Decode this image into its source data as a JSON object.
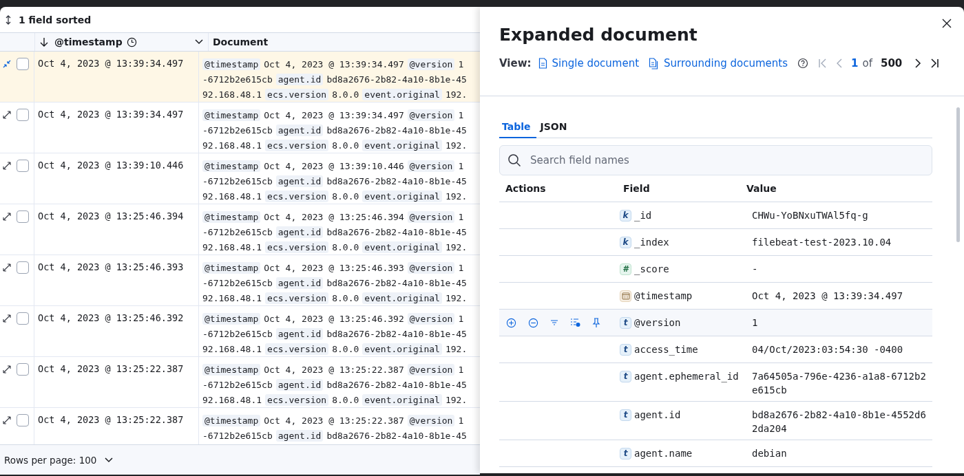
{
  "toolbar": {
    "sort_label": "1 field sorted"
  },
  "grid": {
    "columns": [
      {
        "label": "@timestamp",
        "kind": "time"
      },
      {
        "label": "Document",
        "kind": "document"
      }
    ],
    "rows": [
      {
        "expanded": true,
        "checked": false,
        "timestamp": "Oct 4, 2023 @ 13:39:34.497",
        "document": [
          [
            {
              "kind": "key",
              "text": "@timestamp"
            },
            {
              "kind": "value",
              "text": "Oct 4, 2023 @ 13:39:34.497"
            },
            {
              "kind": "key",
              "text": "@version"
            },
            {
              "kind": "value",
              "text": "1"
            }
          ],
          [
            {
              "kind": "value",
              "text": "-6712b2e615cb"
            },
            {
              "kind": "key",
              "text": "agent.id"
            },
            {
              "kind": "value",
              "text": "bd8a2676-2b82-4a10-8b1e-45"
            }
          ],
          [
            {
              "kind": "value",
              "text": "92.168.48.1"
            },
            {
              "kind": "key",
              "text": "ecs.version"
            },
            {
              "kind": "value",
              "text": "8.0.0"
            },
            {
              "kind": "key",
              "text": "event.original"
            },
            {
              "kind": "value",
              "text": "192."
            }
          ]
        ]
      },
      {
        "expanded": false,
        "checked": false,
        "timestamp": "Oct 4, 2023 @ 13:39:34.497",
        "document": [
          [
            {
              "kind": "key",
              "text": "@timestamp"
            },
            {
              "kind": "value",
              "text": "Oct 4, 2023 @ 13:39:34.497"
            },
            {
              "kind": "key",
              "text": "@version"
            },
            {
              "kind": "value",
              "text": "1"
            }
          ],
          [
            {
              "kind": "value",
              "text": "-6712b2e615cb"
            },
            {
              "kind": "key",
              "text": "agent.id"
            },
            {
              "kind": "value",
              "text": "bd8a2676-2b82-4a10-8b1e-45"
            }
          ],
          [
            {
              "kind": "value",
              "text": "92.168.48.1"
            },
            {
              "kind": "key",
              "text": "ecs.version"
            },
            {
              "kind": "value",
              "text": "8.0.0"
            },
            {
              "kind": "key",
              "text": "event.original"
            },
            {
              "kind": "value",
              "text": "192."
            }
          ]
        ]
      },
      {
        "expanded": false,
        "checked": false,
        "timestamp": "Oct 4, 2023 @ 13:39:10.446",
        "document": [
          [
            {
              "kind": "key",
              "text": "@timestamp"
            },
            {
              "kind": "value",
              "text": "Oct 4, 2023 @ 13:39:10.446"
            },
            {
              "kind": "key",
              "text": "@version"
            },
            {
              "kind": "value",
              "text": "1"
            }
          ],
          [
            {
              "kind": "value",
              "text": "-6712b2e615cb"
            },
            {
              "kind": "key",
              "text": "agent.id"
            },
            {
              "kind": "value",
              "text": "bd8a2676-2b82-4a10-8b1e-45"
            }
          ],
          [
            {
              "kind": "value",
              "text": "92.168.48.1"
            },
            {
              "kind": "key",
              "text": "ecs.version"
            },
            {
              "kind": "value",
              "text": "8.0.0"
            },
            {
              "kind": "key",
              "text": "event.original"
            },
            {
              "kind": "value",
              "text": "192."
            }
          ]
        ]
      },
      {
        "expanded": false,
        "checked": false,
        "timestamp": "Oct 4, 2023 @ 13:25:46.394",
        "document": [
          [
            {
              "kind": "key",
              "text": "@timestamp"
            },
            {
              "kind": "value",
              "text": "Oct 4, 2023 @ 13:25:46.394"
            },
            {
              "kind": "key",
              "text": "@version"
            },
            {
              "kind": "value",
              "text": "1"
            }
          ],
          [
            {
              "kind": "value",
              "text": "-6712b2e615cb"
            },
            {
              "kind": "key",
              "text": "agent.id"
            },
            {
              "kind": "value",
              "text": "bd8a2676-2b82-4a10-8b1e-45"
            }
          ],
          [
            {
              "kind": "value",
              "text": "92.168.48.1"
            },
            {
              "kind": "key",
              "text": "ecs.version"
            },
            {
              "kind": "value",
              "text": "8.0.0"
            },
            {
              "kind": "key",
              "text": "event.original"
            },
            {
              "kind": "value",
              "text": "192."
            }
          ]
        ]
      },
      {
        "expanded": false,
        "checked": false,
        "timestamp": "Oct 4, 2023 @ 13:25:46.393",
        "document": [
          [
            {
              "kind": "key",
              "text": "@timestamp"
            },
            {
              "kind": "value",
              "text": "Oct 4, 2023 @ 13:25:46.393"
            },
            {
              "kind": "key",
              "text": "@version"
            },
            {
              "kind": "value",
              "text": "1"
            }
          ],
          [
            {
              "kind": "value",
              "text": "-6712b2e615cb"
            },
            {
              "kind": "key",
              "text": "agent.id"
            },
            {
              "kind": "value",
              "text": "bd8a2676-2b82-4a10-8b1e-45"
            }
          ],
          [
            {
              "kind": "value",
              "text": "92.168.48.1"
            },
            {
              "kind": "key",
              "text": "ecs.version"
            },
            {
              "kind": "value",
              "text": "8.0.0"
            },
            {
              "kind": "key",
              "text": "event.original"
            },
            {
              "kind": "value",
              "text": "192."
            }
          ]
        ]
      },
      {
        "expanded": false,
        "checked": false,
        "timestamp": "Oct 4, 2023 @ 13:25:46.392",
        "document": [
          [
            {
              "kind": "key",
              "text": "@timestamp"
            },
            {
              "kind": "value",
              "text": "Oct 4, 2023 @ 13:25:46.392"
            },
            {
              "kind": "key",
              "text": "@version"
            },
            {
              "kind": "value",
              "text": "1"
            }
          ],
          [
            {
              "kind": "value",
              "text": "-6712b2e615cb"
            },
            {
              "kind": "key",
              "text": "agent.id"
            },
            {
              "kind": "value",
              "text": "bd8a2676-2b82-4a10-8b1e-45"
            }
          ],
          [
            {
              "kind": "value",
              "text": "92.168.48.1"
            },
            {
              "kind": "key",
              "text": "ecs.version"
            },
            {
              "kind": "value",
              "text": "8.0.0"
            },
            {
              "kind": "key",
              "text": "event.original"
            },
            {
              "kind": "value",
              "text": "192."
            }
          ]
        ]
      },
      {
        "expanded": false,
        "checked": false,
        "timestamp": "Oct 4, 2023 @ 13:25:22.387",
        "document": [
          [
            {
              "kind": "key",
              "text": "@timestamp"
            },
            {
              "kind": "value",
              "text": "Oct 4, 2023 @ 13:25:22.387"
            },
            {
              "kind": "key",
              "text": "@version"
            },
            {
              "kind": "value",
              "text": "1"
            }
          ],
          [
            {
              "kind": "value",
              "text": "-6712b2e615cb"
            },
            {
              "kind": "key",
              "text": "agent.id"
            },
            {
              "kind": "value",
              "text": "bd8a2676-2b82-4a10-8b1e-45"
            }
          ],
          [
            {
              "kind": "value",
              "text": "92.168.48.1"
            },
            {
              "kind": "key",
              "text": "ecs.version"
            },
            {
              "kind": "value",
              "text": "8.0.0"
            },
            {
              "kind": "key",
              "text": "event.original"
            },
            {
              "kind": "value",
              "text": "192."
            }
          ]
        ]
      },
      {
        "expanded": false,
        "checked": false,
        "timestamp": "Oct 4, 2023 @ 13:25:22.387",
        "document": [
          [
            {
              "kind": "key",
              "text": "@timestamp"
            },
            {
              "kind": "value",
              "text": "Oct 4, 2023 @ 13:25:22.387"
            },
            {
              "kind": "key",
              "text": "@version"
            },
            {
              "kind": "value",
              "text": "1"
            }
          ],
          [
            {
              "kind": "value",
              "text": "-6712b2e615cb"
            },
            {
              "kind": "key",
              "text": "agent.id"
            },
            {
              "kind": "value",
              "text": "bd8a2676-2b82-4a10-8b1e-45"
            }
          ]
        ]
      }
    ]
  },
  "pagination": {
    "rows_per_page": "Rows per page: 100"
  },
  "flyout": {
    "title": "Expanded document",
    "view_label": "View:",
    "views": [
      {
        "kind": "single",
        "label": "Single document"
      },
      {
        "kind": "surrounding",
        "label": "Surrounding documents"
      }
    ],
    "pager": {
      "current": "1",
      "of": "of",
      "total": "500"
    },
    "tabs": [
      {
        "label": "Table",
        "selected": true
      },
      {
        "label": "JSON",
        "selected": false
      }
    ],
    "search": {
      "placeholder": "Search field names"
    },
    "columns": [
      "Actions",
      "Field",
      "Value"
    ],
    "fields": [
      {
        "kind": "keyword",
        "badge": "k",
        "name": "_id",
        "value": "CHWu-YoBNxuTWAl5fq-g",
        "highlighted": false
      },
      {
        "kind": "keyword",
        "badge": "k",
        "name": "_index",
        "value": "filebeat-test-2023.10.04",
        "highlighted": false
      },
      {
        "kind": "number",
        "badge": "#",
        "name": "_score",
        "value": "-",
        "highlighted": false
      },
      {
        "kind": "date",
        "name": "@timestamp",
        "value": "Oct 4, 2023 @ 13:39:34.497",
        "highlighted": false
      },
      {
        "kind": "text",
        "badge": "t",
        "name": "@version",
        "value": "1",
        "highlighted": true
      },
      {
        "kind": "text",
        "badge": "t",
        "name": "access_time",
        "value": "04/Oct/2023:03:54:30 -0400",
        "highlighted": false
      },
      {
        "kind": "text",
        "badge": "t",
        "name": "agent.ephemeral_id",
        "value": "7a64505a-796e-4236-a1a8-6712b2e615cb",
        "highlighted": false
      },
      {
        "kind": "text",
        "badge": "t",
        "name": "agent.id",
        "value": "bd8a2676-2b82-4a10-8b1e-4552d62da204",
        "highlighted": false
      },
      {
        "kind": "text",
        "badge": "t",
        "name": "agent.name",
        "value": "debian",
        "highlighted": false
      }
    ]
  }
}
